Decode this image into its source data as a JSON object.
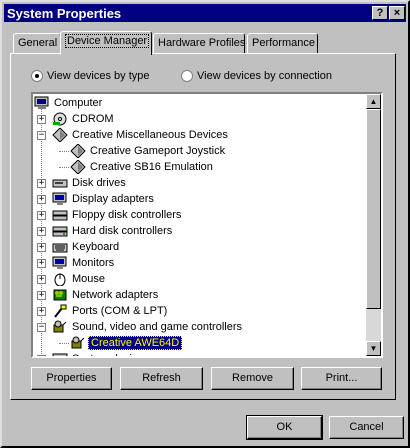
{
  "window": {
    "title": "System Properties",
    "help_btn": "?",
    "close_btn": "×"
  },
  "tabs": [
    {
      "label": "General"
    },
    {
      "label": "Device Manager"
    },
    {
      "label": "Hardware Profiles"
    },
    {
      "label": "Performance"
    }
  ],
  "view": {
    "by_type": "View devices by type",
    "by_connection": "View devices by connection",
    "selected": "by_type"
  },
  "tree": {
    "root": "Computer",
    "items": [
      {
        "label": "CDROM",
        "icon": "cdrom-icon",
        "expander": "+"
      },
      {
        "label": "Creative Miscellaneous Devices",
        "icon": "misc-device-icon",
        "expander": "−"
      },
      {
        "label": "Creative Gameport Joystick",
        "icon": "misc-device-icon",
        "child": true
      },
      {
        "label": "Creative SB16 Emulation",
        "icon": "misc-device-icon",
        "child": true
      },
      {
        "label": "Disk drives",
        "icon": "disk-drive-icon",
        "expander": "+"
      },
      {
        "label": "Display adapters",
        "icon": "display-adapter-icon",
        "expander": "+"
      },
      {
        "label": "Floppy disk controllers",
        "icon": "floppy-controller-icon",
        "expander": "+"
      },
      {
        "label": "Hard disk controllers",
        "icon": "hard-disk-controller-icon",
        "expander": "+"
      },
      {
        "label": "Keyboard",
        "icon": "keyboard-icon",
        "expander": "+"
      },
      {
        "label": "Monitors",
        "icon": "monitor-icon",
        "expander": "+"
      },
      {
        "label": "Mouse",
        "icon": "mouse-icon",
        "expander": "+"
      },
      {
        "label": "Network adapters",
        "icon": "network-adapter-icon",
        "expander": "+"
      },
      {
        "label": "Ports (COM & LPT)",
        "icon": "ports-icon",
        "expander": "+"
      },
      {
        "label": "Sound, video and game controllers",
        "icon": "sound-icon",
        "expander": "−"
      },
      {
        "label": "Creative AWE64D",
        "icon": "sound-icon",
        "child": true,
        "selected": true
      },
      {
        "label": "System devices",
        "icon": "system-devices-icon",
        "expander": "+"
      }
    ]
  },
  "buttons": {
    "properties": "Properties",
    "refresh": "Refresh",
    "remove": "Remove",
    "print": "Print...",
    "ok": "OK",
    "cancel": "Cancel"
  }
}
